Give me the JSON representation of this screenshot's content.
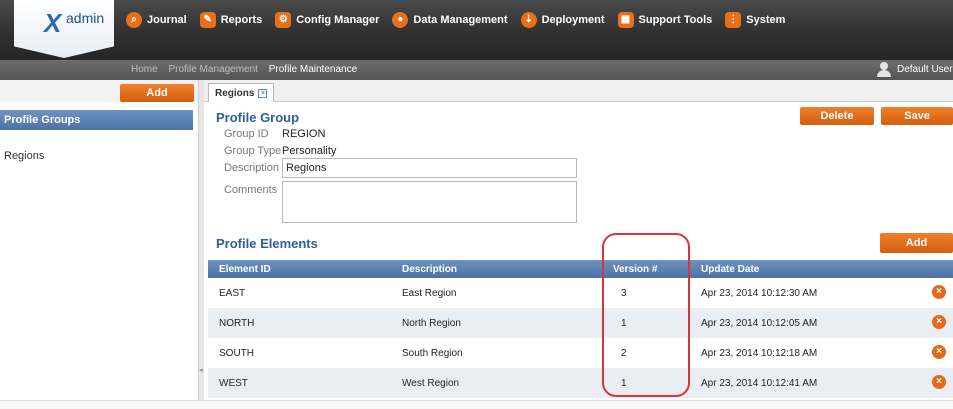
{
  "app": {
    "logo_text": "admin",
    "logo_icon": "x-logo-icon",
    "accent_color": "#e8701a",
    "header_color": "#4c72a6"
  },
  "nav": [
    {
      "label": "Journal",
      "icon": "search-icon",
      "glyph": "🔍"
    },
    {
      "label": "Reports",
      "icon": "edit-icon",
      "glyph": "✎"
    },
    {
      "label": "Config Manager",
      "icon": "gear-icon",
      "glyph": "⚙"
    },
    {
      "label": "Data Management",
      "icon": "database-icon",
      "glyph": "●"
    },
    {
      "label": "Deployment",
      "icon": "deployment-icon",
      "glyph": "⇣"
    },
    {
      "label": "Support Tools",
      "icon": "toolbox-icon",
      "glyph": "▦"
    },
    {
      "label": "System",
      "icon": "system-icon",
      "glyph": "⋮"
    }
  ],
  "breadcrumb": [
    "Home",
    "Profile Management",
    "Profile Maintenance"
  ],
  "user": {
    "name": "Default User"
  },
  "left": {
    "add_label": "Add",
    "header": "Profile Groups",
    "items": [
      "Regions"
    ]
  },
  "tab": {
    "label": "Regions"
  },
  "profile_group": {
    "title": "Profile Group",
    "delete_label": "Delete",
    "save_label": "Save",
    "group_id_label": "Group ID",
    "group_id": "REGION",
    "group_type_label": "Group Type",
    "group_type": "Personality",
    "description_label": "Description",
    "description": "Regions",
    "comments_label": "Comments",
    "comments": ""
  },
  "profile_elements": {
    "title": "Profile Elements",
    "add_label": "Add",
    "columns": [
      "Element ID",
      "Description",
      "Version #",
      "Update Date"
    ],
    "rows": [
      {
        "id": "EAST",
        "description": "East Region",
        "version": "3",
        "date": "Apr 23, 2014 10:12:30 AM"
      },
      {
        "id": "NORTH",
        "description": "North Region",
        "version": "1",
        "date": "Apr 23, 2014 10:12:05 AM"
      },
      {
        "id": "SOUTH",
        "description": "South Region",
        "version": "2",
        "date": "Apr 23, 2014 10:12:18 AM"
      },
      {
        "id": "WEST",
        "description": "West Region",
        "version": "1",
        "date": "Apr 23, 2014 10:12:41 AM"
      }
    ]
  }
}
